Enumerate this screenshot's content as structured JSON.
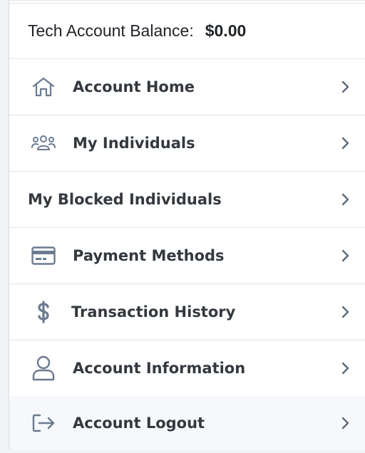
{
  "balance": {
    "label": "Tech Account Balance:",
    "value": "$0.00"
  },
  "menu": [
    {
      "label": "Account Home",
      "icon": "home-icon"
    },
    {
      "label": "My Individuals",
      "icon": "people-icon"
    },
    {
      "label": "My Blocked Individuals",
      "icon": ""
    },
    {
      "label": "Payment Methods",
      "icon": "credit-card-icon"
    },
    {
      "label": "Transaction History",
      "icon": "dollar-icon"
    },
    {
      "label": "Account Information",
      "icon": "user-icon"
    },
    {
      "label": "Account Logout",
      "icon": "logout-icon"
    }
  ],
  "colors": {
    "icon": "#6b7a8f",
    "text": "#34393f",
    "chevron": "#5f6b7a",
    "divider": "#e1e4e8"
  }
}
